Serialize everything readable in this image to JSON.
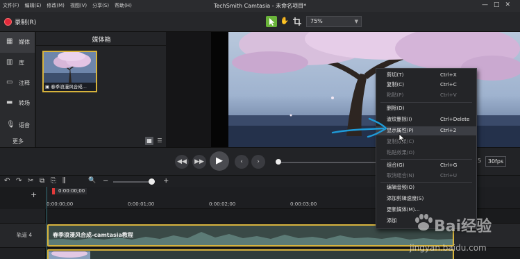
{
  "app": {
    "title": "TechSmith Camtasia - 未命名项目*",
    "menus": [
      "文件(F)",
      "编辑(E)",
      "修改(M)",
      "视图(V)",
      "分享(S)",
      "帮助(H)"
    ]
  },
  "toolbar": {
    "record_label": "录制(R)",
    "zoom_value": "75%"
  },
  "left_tools": [
    {
      "label": "媒体",
      "icon": "film-icon"
    },
    {
      "label": "库",
      "icon": "library-icon"
    },
    {
      "label": "注释",
      "icon": "annotation-icon"
    },
    {
      "label": "转场",
      "icon": "transition-icon"
    },
    {
      "label": "语音",
      "icon": "microphone-icon"
    }
  ],
  "more_label": "更多",
  "media_bin": {
    "title": "媒体箱",
    "item_caption": "春季浪漫风合成..."
  },
  "playback": {
    "fps": "30fps",
    "fps_prefix": "5"
  },
  "timeline": {
    "playhead_time": "0:00:00;00",
    "ticks": [
      "0:00:00;00",
      "0:00:01;00",
      "0:00:02;00",
      "0:00:03;00"
    ],
    "track_label": "轨道 4",
    "clip_label": "春季浪漫风合成-camtasia教程"
  },
  "context_menu": {
    "items": [
      {
        "label": "剪切(T)",
        "shortcut": "Ctrl+X",
        "enabled": true
      },
      {
        "label": "复制(C)",
        "shortcut": "Ctrl+C",
        "enabled": true
      },
      {
        "label": "粘贴(P)",
        "shortcut": "Ctrl+V",
        "enabled": false
      },
      {
        "label": "删除(D)",
        "shortcut": "",
        "enabled": true
      },
      {
        "label": "波纹删除(I)",
        "shortcut": "Ctrl+Delete",
        "enabled": true
      },
      {
        "label": "显示属性(P)",
        "shortcut": "Ctrl+2",
        "enabled": true,
        "highlighted": true
      },
      {
        "label": "复制效果(C)",
        "shortcut": "",
        "enabled": false
      },
      {
        "label": "粘贴效果(O)",
        "shortcut": "",
        "enabled": false
      },
      {
        "label": "组合(G)",
        "shortcut": "Ctrl+G",
        "enabled": true
      },
      {
        "label": "取消组合(N)",
        "shortcut": "Ctrl+U",
        "enabled": false
      },
      {
        "label": "编辑音频(O)",
        "shortcut": "",
        "enabled": true
      },
      {
        "label": "添加剪辑速度(S)",
        "shortcut": "",
        "enabled": true
      },
      {
        "label": "更新媒体(M)...",
        "shortcut": "",
        "enabled": true
      },
      {
        "label": "添加",
        "shortcut": "",
        "enabled": true
      }
    ]
  },
  "watermark": {
    "brand": "Bai",
    "brand_suffix": "经验",
    "url": "jingyan.baidu.com"
  },
  "colors": {
    "accent_green": "#6ab43a",
    "record_red": "#e2293b",
    "selection_gold": "#d7b33c",
    "annotation_blue": "#1f9bd8"
  }
}
